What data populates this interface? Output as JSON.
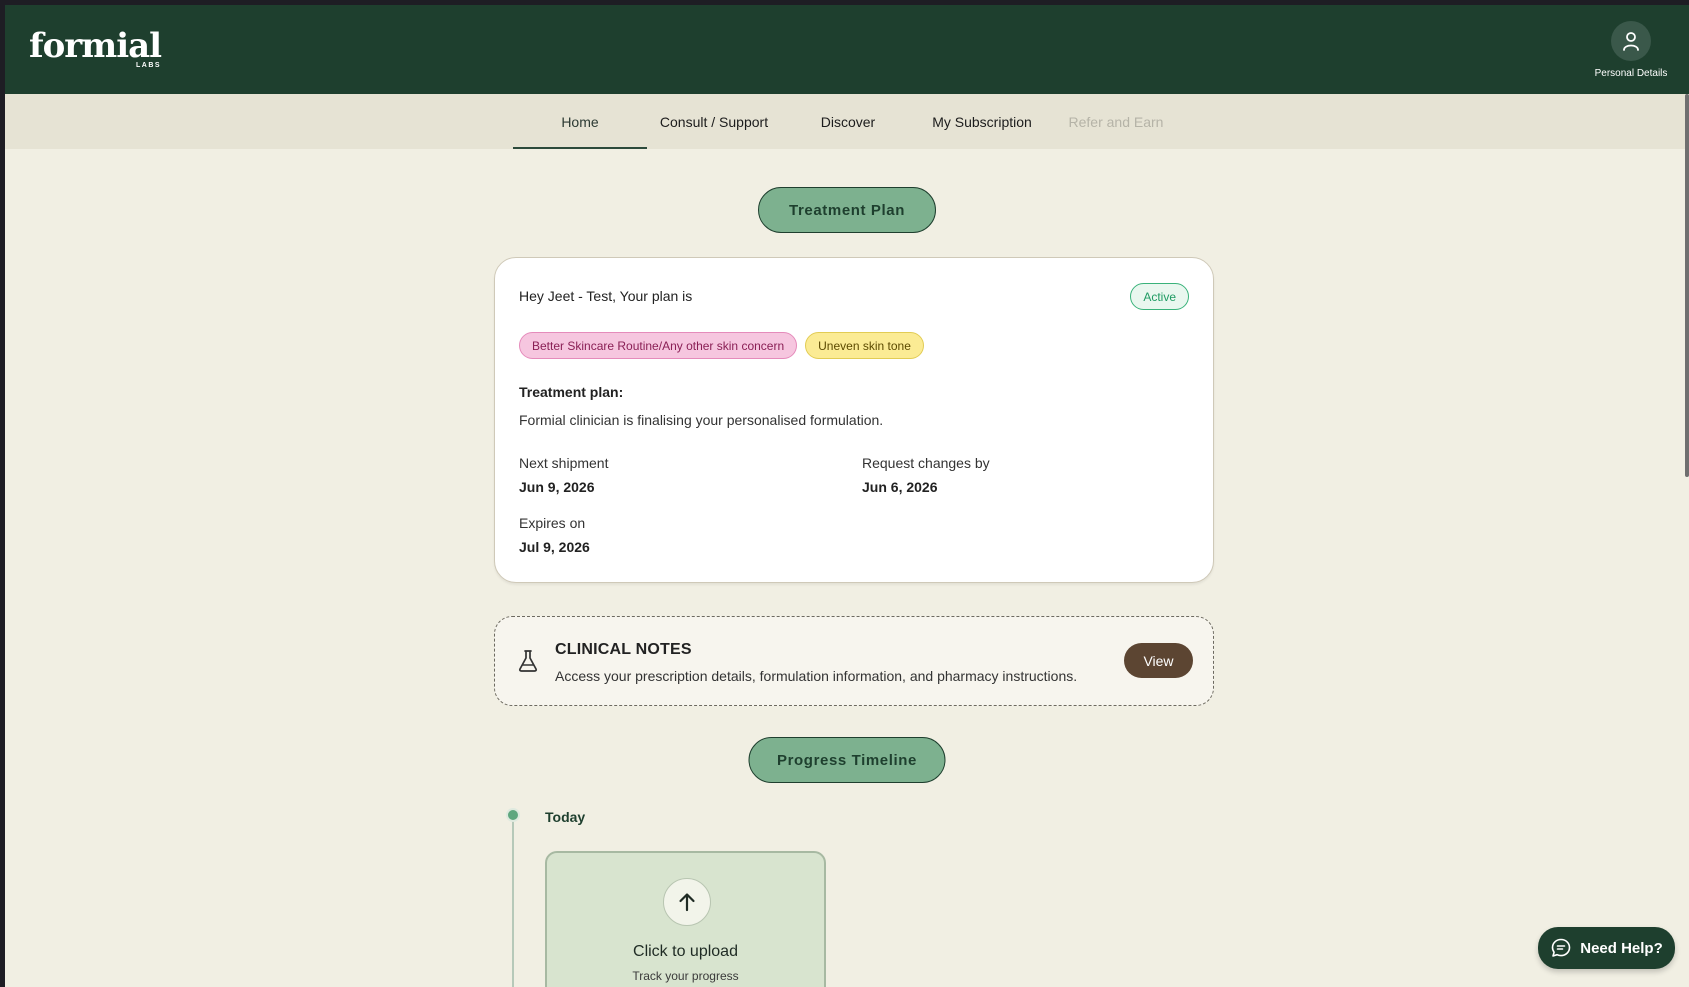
{
  "header": {
    "logo_text": "formial",
    "logo_sub": "LABS",
    "profile_label": "Personal Details"
  },
  "nav": {
    "items": [
      {
        "label": "Home"
      },
      {
        "label": "Consult / Support"
      },
      {
        "label": "Discover"
      },
      {
        "label": "My Subscription"
      },
      {
        "label": "Refer and Earn"
      }
    ]
  },
  "treatment_section": {
    "heading": "Treatment Plan",
    "greeting": "Hey Jeet - Test, Your plan is",
    "status": "Active",
    "tags": [
      "Better Skincare Routine/Any other skin concern",
      "Uneven skin tone"
    ],
    "plan_label": "Treatment plan:",
    "plan_text": "Formial clinician is finalising your personalised formulation.",
    "next_shipment_label": "Next shipment",
    "next_shipment_value": "Jun 9, 2026",
    "request_changes_label": "Request changes by",
    "request_changes_value": "Jun 6, 2026",
    "expires_label": "Expires on",
    "expires_value": "Jul 9, 2026"
  },
  "clinical_notes": {
    "title": "CLINICAL NOTES",
    "description": "Access your prescription details, formulation information, and pharmacy instructions.",
    "button": "View",
    "icon": "flask-icon"
  },
  "progress_section": {
    "heading": "Progress Timeline",
    "today_label": "Today",
    "upload_title": "Click to upload",
    "upload_subtitle": "Track your progress",
    "upload_icon": "arrow-up-icon"
  },
  "help": {
    "label": "Need Help?",
    "icon": "chat-icon"
  },
  "colors": {
    "header_bg": "#1e3f2e",
    "page_bg": "#f1efe3",
    "accent_green": "#7db18f",
    "view_button": "#5c4532"
  }
}
